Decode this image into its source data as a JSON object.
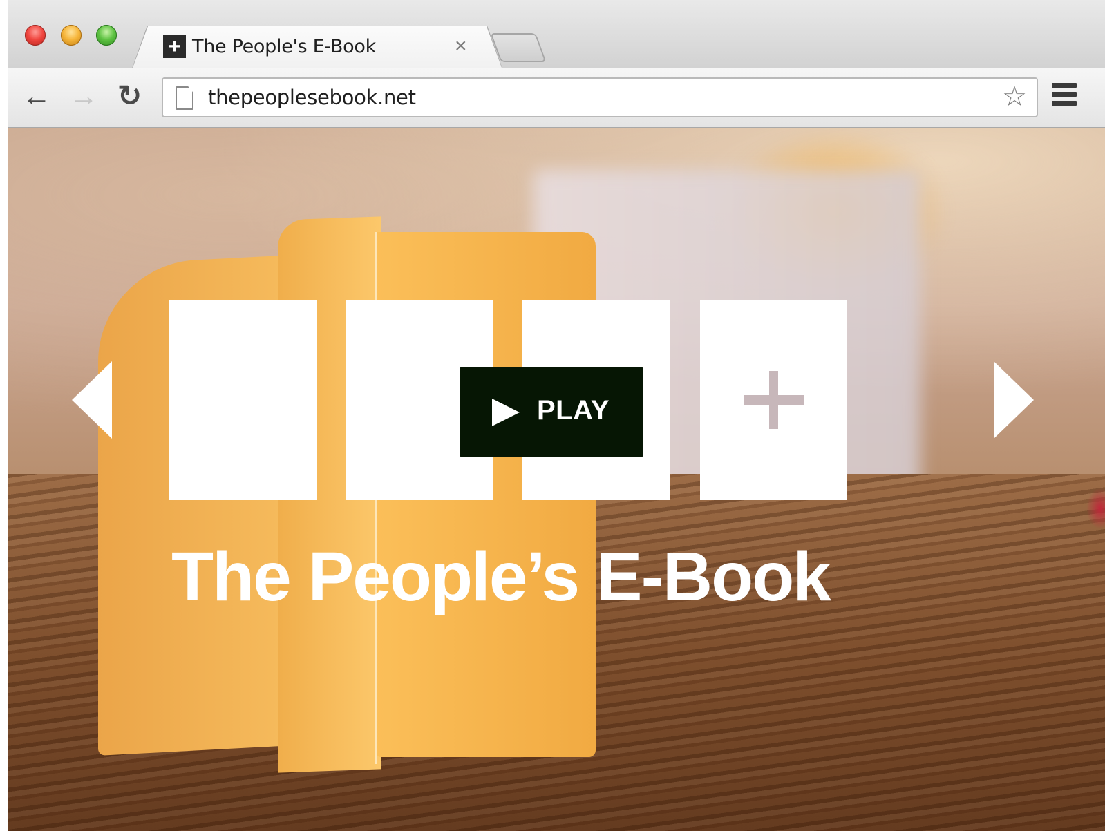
{
  "browser": {
    "tab": {
      "title": "The People's E-Book",
      "favicon_glyph": "+",
      "close_glyph": "×"
    },
    "toolbar": {
      "back_icon": "←",
      "forward_icon": "→",
      "reload_icon": "↻",
      "url": "thepeoplesebook.net",
      "star_icon": "☆"
    }
  },
  "page": {
    "hero_title": "The People’s E-Book",
    "play_label": "PLAY",
    "cards": [
      "",
      "",
      "",
      "+"
    ],
    "colors": {
      "play_bg": "#061604",
      "card_bg": "#ffffff",
      "plus": "#c7b7ba",
      "paper_orange": "#f7b44f"
    }
  }
}
